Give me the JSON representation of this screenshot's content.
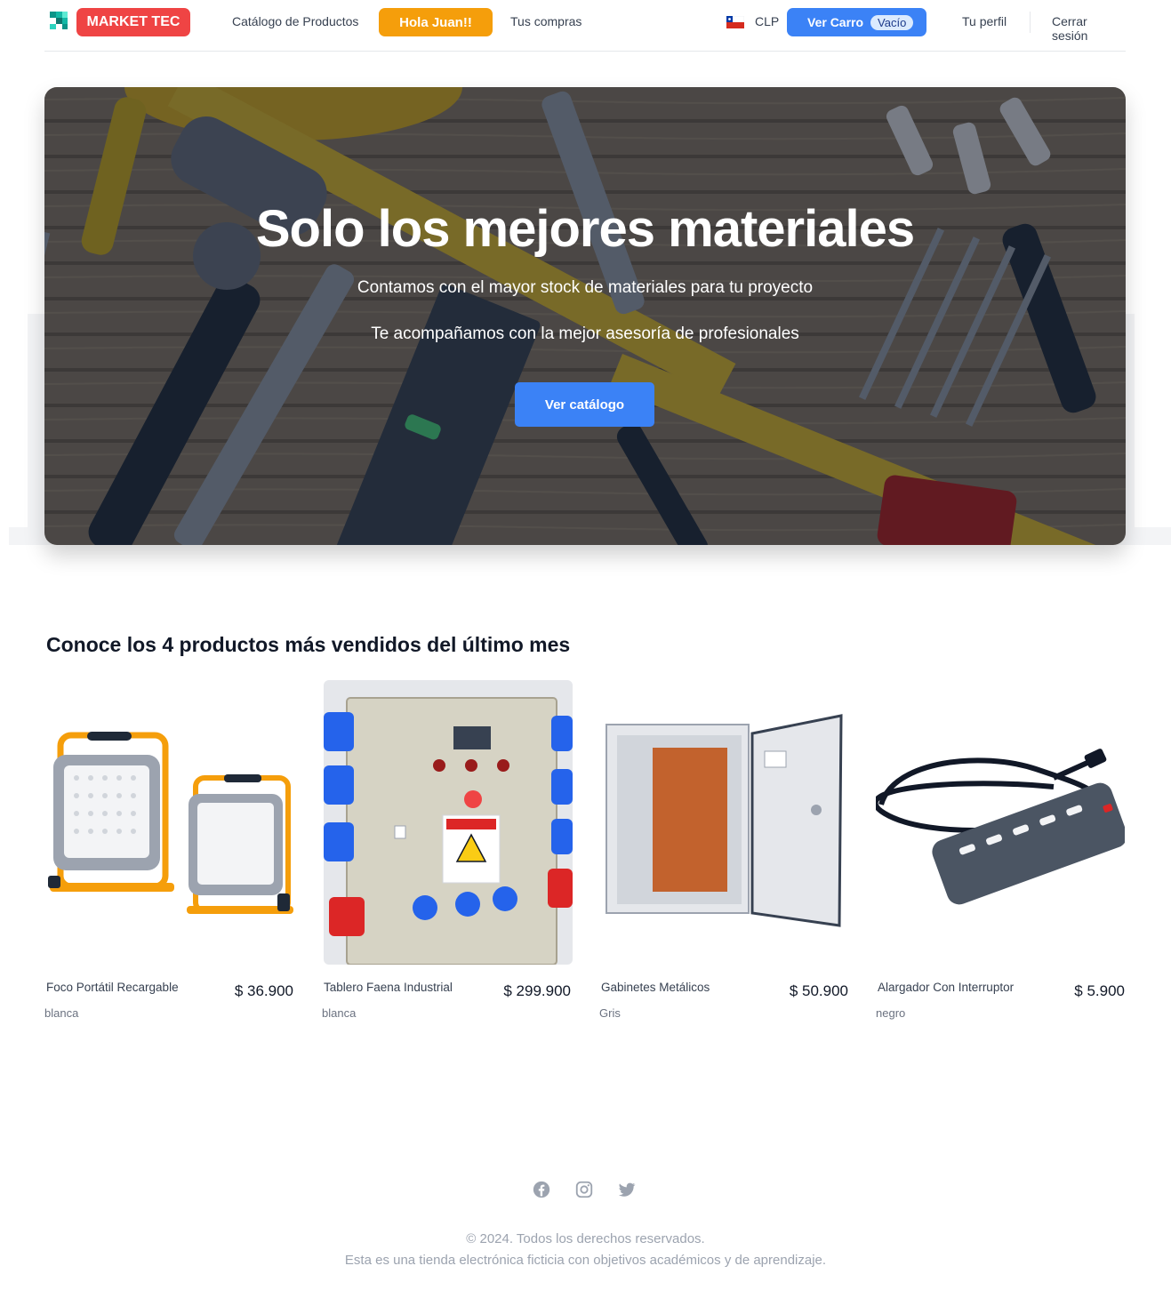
{
  "nav": {
    "brand": "MARKET TEC",
    "catalog_link": "Catálogo de Productos",
    "greeting": "Hola Juan!!",
    "purchases_link": "Tus compras",
    "currency": "CLP",
    "cart_label": "Ver Carro",
    "cart_badge": "Vacío",
    "profile_link": "Tu perfil",
    "logout_link": "Cerrar sesión"
  },
  "hero": {
    "title": "Solo los mejores materiales",
    "subtitle_1": "Contamos con el mayor stock de materiales para tu proyecto",
    "subtitle_2": "Te acompañamos con la mejor asesoría de profesionales",
    "cta": "Ver catálogo"
  },
  "products": {
    "title": "Conoce los 4 productos más vendidos del último mes",
    "items": [
      {
        "name": "Foco Portátil Recargable",
        "price": "$ 36.900",
        "color": "blanca"
      },
      {
        "name": "Tablero Faena Industrial",
        "price": "$ 299.900",
        "color": "blanca"
      },
      {
        "name": "Gabinetes Metálicos",
        "price": "$ 50.900",
        "color": "Gris"
      },
      {
        "name": "Alargador Con Interruptor",
        "price": "$ 5.900",
        "color": "negro"
      }
    ]
  },
  "footer": {
    "copyright": "© 2024. Todos los derechos reservados.",
    "disclaimer": "Esta es una tienda electrónica ficticia con objetivos académicos y de aprendizaje."
  },
  "colors": {
    "brand_red": "#ef4444",
    "greeting_orange": "#f59e0b",
    "primary_blue": "#3b82f6"
  }
}
